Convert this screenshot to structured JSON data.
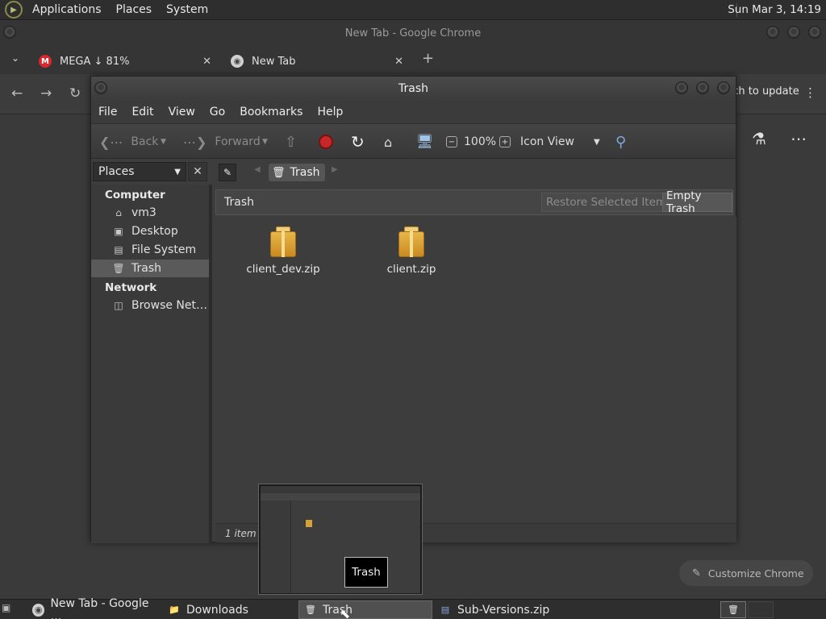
{
  "top_panel": {
    "menus": [
      "Applications",
      "Places",
      "System"
    ],
    "clock": "Sun Mar  3, 14:19"
  },
  "chrome": {
    "window_title": "New Tab - Google Chrome",
    "tabs": [
      {
        "label": "MEGA ↓ 81%",
        "favicon": "mega-icon"
      },
      {
        "label": "New Tab",
        "favicon": "chrome-icon"
      }
    ],
    "new_tab_glyph": "+",
    "update_button_label": "nch to update",
    "customize_label": "Customize Chrome"
  },
  "nautilus": {
    "title": "Trash",
    "menus": [
      "File",
      "Edit",
      "View",
      "Go",
      "Bookmarks",
      "Help"
    ],
    "toolbar": {
      "back": "Back",
      "forward": "Forward",
      "zoom": "100%",
      "view_mode": "Icon View"
    },
    "sidebar": {
      "places_label": "Places",
      "sections": [
        {
          "heading": "Computer",
          "items": [
            {
              "label": "vm3",
              "icon": "home-folder-icon"
            },
            {
              "label": "Desktop",
              "icon": "desktop-folder-icon"
            },
            {
              "label": "File System",
              "icon": "drive-icon"
            },
            {
              "label": "Trash",
              "icon": "trash-icon",
              "selected": true
            }
          ]
        },
        {
          "heading": "Network",
          "items": [
            {
              "label": "Browse Net…",
              "icon": "network-icon"
            }
          ]
        }
      ]
    },
    "path_crumb": "Trash",
    "trash_bar": {
      "label": "Trash",
      "restore_label": "Restore Selected Items",
      "empty_label": "Empty Trash"
    },
    "files": [
      {
        "name": "client_dev.zip",
        "icon": "package-icon"
      },
      {
        "name": "client.zip",
        "icon": "package-icon"
      }
    ],
    "status": "1 item"
  },
  "preview_tooltip": "Trash",
  "taskbar": {
    "tasks": [
      {
        "label": "New Tab - Google …",
        "icon": "chrome-icon"
      },
      {
        "label": "Downloads",
        "icon": "folder-icon"
      },
      {
        "label": "Trash",
        "icon": "trash-icon",
        "active": true
      },
      {
        "label": "Sub-Versions.zip",
        "icon": "archive-icon"
      }
    ]
  }
}
